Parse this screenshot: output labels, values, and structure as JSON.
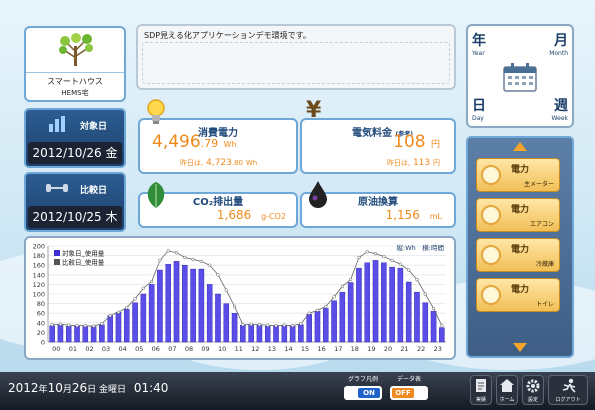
{
  "house": {
    "name": "スマートハウス",
    "sub": "HEMS宅"
  },
  "message": "SDP見える化アプリケーションデモ環境です。",
  "target": {
    "label": "対象日",
    "date": "2012/10/26 金"
  },
  "compare": {
    "label": "比較日",
    "date": "2012/10/25 木"
  },
  "metrics": {
    "power": {
      "title": "消費電力",
      "value_int": "4,496",
      "value_dec": ".79",
      "unit": "Wh",
      "prev_prefix": "昨日は,",
      "prev_int": "4,723",
      "prev_dec": ".80",
      "prev_unit": "Wh"
    },
    "cost": {
      "title": "電気料金",
      "note": "(参考)",
      "value": "108",
      "unit": "円",
      "prev_prefix": "昨日は,",
      "prev_value": "113",
      "prev_unit": "円"
    },
    "co2": {
      "title": "CO₂排出量",
      "value": "1,686",
      "unit": "g-CO2"
    },
    "oil": {
      "title": "原油換算",
      "value": "1,156",
      "unit": "mL"
    }
  },
  "period": {
    "year": "年",
    "year_en": "Year",
    "month": "月",
    "month_en": "Month",
    "day": "日",
    "day_en": "Day",
    "week": "週",
    "week_en": "Week"
  },
  "devices": [
    {
      "label": "電力",
      "sub": "主メーター"
    },
    {
      "label": "電力",
      "sub": "エアコン"
    },
    {
      "label": "電力",
      "sub": "冷蔵庫"
    },
    {
      "label": "電力",
      "sub": "トイレ"
    }
  ],
  "chart_data": {
    "type": "bar",
    "unit_note": "縦:Wh　横:時間",
    "ylim": [
      0,
      200
    ],
    "yticks": [
      0,
      20,
      40,
      60,
      80,
      100,
      120,
      140,
      160,
      180,
      200
    ],
    "categories": [
      "00",
      "01",
      "02",
      "03",
      "04",
      "05",
      "06",
      "07",
      "08",
      "09",
      "10",
      "11",
      "12",
      "13",
      "14",
      "15",
      "16",
      "17",
      "18",
      "19",
      "20",
      "21",
      "22",
      "23"
    ],
    "series": [
      {
        "name": "対象日_使用量",
        "color": "#3c2fd6",
        "values": [
          34,
          36,
          33,
          33,
          32,
          32,
          36,
          55,
          62,
          68,
          82,
          100,
          120,
          150,
          162,
          168,
          160,
          152,
          152,
          120,
          100,
          80,
          60,
          35,
          36,
          35,
          33,
          33,
          34,
          33,
          36,
          58,
          64,
          70,
          86,
          104,
          124,
          154,
          165,
          170,
          165,
          156,
          154,
          125,
          104,
          82,
          64,
          30
        ]
      },
      {
        "name": "比較日_使用量",
        "color": "#555555",
        "values": [
          36,
          37,
          35,
          34,
          34,
          33,
          38,
          55,
          62,
          72,
          90,
          112,
          126,
          170,
          190,
          186,
          176,
          172,
          168,
          160,
          140,
          108,
          74,
          36,
          37,
          36,
          35,
          34,
          35,
          34,
          38,
          60,
          66,
          74,
          94,
          116,
          130,
          176,
          188,
          184,
          178,
          170,
          162,
          150,
          130,
          100,
          70,
          34
        ]
      }
    ]
  },
  "footer": {
    "datetime_y": "2012",
    "datetime_yl": "年",
    "datetime_m": "10",
    "datetime_ml": "月",
    "datetime_d": "26",
    "datetime_dl": "日 金曜日",
    "datetime_t": "01:40",
    "graph_legend_label": "グラフ凡例",
    "graph_legend_state": "ON",
    "data_table_label": "データ表",
    "data_table_state": "OFF",
    "actions": [
      "実績",
      "ホーム",
      "設定",
      "ログアウト"
    ]
  }
}
